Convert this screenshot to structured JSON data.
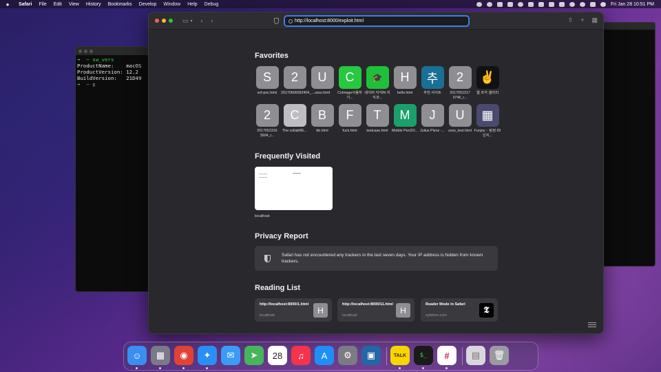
{
  "menubar": {
    "app": "Safari",
    "items": [
      "File",
      "Edit",
      "View",
      "History",
      "Bookmarks",
      "Develop",
      "Window",
      "Help",
      "Debug"
    ],
    "clock": "Fri Jan 28  10:51 PM"
  },
  "terminal": {
    "lines": [
      {
        "prompt": "➜  ~ ",
        "text": "sw_vers"
      },
      {
        "prompt": "",
        "text": "ProductName:    macOS"
      },
      {
        "prompt": "",
        "text": "ProductVersion: 12.2"
      },
      {
        "prompt": "",
        "text": "BuildVersion:   21D49"
      },
      {
        "prompt": "➜  ~ ",
        "text": "▯"
      }
    ]
  },
  "safari": {
    "url": "http://localhost:8000/exploit.html",
    "favorites_title": "Favorites",
    "favorites": [
      {
        "glyph": "S",
        "label": "sof-poc.html",
        "color": "#8e8e93"
      },
      {
        "glyph": "2",
        "label": "20170606092404_...",
        "color": "#8e8e93"
      },
      {
        "glyph": "U",
        "label": "uxss.html",
        "color": "#8e8e93"
      },
      {
        "glyph": "C",
        "label": "CxImage사용하기...",
        "color": "#28c840"
      },
      {
        "glyph": "🎓",
        "label": "네이버 지식iN 지식과...",
        "color": "#1fbf3a"
      },
      {
        "glyph": "H",
        "label": "hello.html",
        "color": "#8e8e93"
      },
      {
        "glyph": "추",
        "label": "추천 사이트",
        "color": "#1a6f96"
      },
      {
        "glyph": "2",
        "label": "2017052317 0746_r...",
        "color": "#8e8e93"
      },
      {
        "glyph": "✌",
        "label": "웹 조각 갤러리",
        "color": "#111111"
      },
      {
        "glyph": "2",
        "label": "2017052316 3904_r...",
        "color": "#8e8e93"
      },
      {
        "glyph": "C",
        "label": "The collabRE...",
        "color": "#bdbdc2"
      },
      {
        "glyph": "B",
        "label": "bb.html",
        "color": "#8e8e93"
      },
      {
        "glyph": "F",
        "label": "fuck.html",
        "color": "#8e8e93"
      },
      {
        "glyph": "T",
        "label": "testcase.html",
        "color": "#8e8e93"
      },
      {
        "glyph": "M",
        "label": "Mobile Pen2O...",
        "color": "#1aa06a"
      },
      {
        "glyph": "J",
        "label": "Julius Plenz -...",
        "color": "#8e8e93"
      },
      {
        "glyph": "U",
        "label": "uxss_test.html",
        "color": "#8e8e93"
      },
      {
        "glyph": "▦",
        "label": "Funjoy :: 탐정 65인지...",
        "color": "#4a4a70"
      }
    ],
    "frequent_title": "Frequently Visited",
    "frequent": [
      {
        "label": "localhost"
      }
    ],
    "privacy_title": "Privacy Report",
    "privacy_text": "Safari has not encountered any trackers in the last seven days. Your IP address is hidden from known trackers.",
    "reading_title": "Reading List",
    "reading": [
      {
        "title": "http://localhost:8000/1.html",
        "sub": "localhost",
        "thumb": "H"
      },
      {
        "title": "http://localhost:8000/11.html",
        "sub": "localhost",
        "thumb": "H"
      },
      {
        "title": "Reader Mode in Safari",
        "sub": "nytimes.com",
        "thumb": "𝕿"
      }
    ]
  },
  "dock": {
    "apps": [
      {
        "name": "finder",
        "glyph": "☺",
        "color": "#3a8ef0"
      },
      {
        "name": "launchpad",
        "glyph": "▦",
        "color": "#7a7a86"
      },
      {
        "name": "chrome",
        "glyph": "◉",
        "color": "#e04235"
      },
      {
        "name": "safari",
        "glyph": "✦",
        "color": "#2a8ef5"
      },
      {
        "name": "mail",
        "glyph": "✉",
        "color": "#3b9cf7"
      },
      {
        "name": "maps",
        "glyph": "➤",
        "color": "#47b55a"
      },
      {
        "name": "calendar",
        "glyph": "28",
        "color": "#ffffff"
      },
      {
        "name": "music",
        "glyph": "♫",
        "color": "#f5334b"
      },
      {
        "name": "app-store",
        "glyph": "A",
        "color": "#1f8ff5"
      },
      {
        "name": "system-preferences",
        "glyph": "⚙",
        "color": "#7b7b82"
      },
      {
        "name": "virtualbox",
        "glyph": "▣",
        "color": "#2466a8"
      },
      {
        "name": "kakaotalk",
        "glyph": "TALK",
        "color": "#f7d600"
      },
      {
        "name": "terminal",
        "glyph": "$_",
        "color": "#1a1a1a"
      },
      {
        "name": "slack",
        "glyph": "#",
        "color": "#ffffff"
      },
      {
        "name": "document",
        "glyph": "▤",
        "color": "#d8d8dc"
      },
      {
        "name": "trash",
        "glyph": "🗑",
        "color": "#9a9aa0"
      }
    ],
    "calendar_month": "JAN"
  }
}
